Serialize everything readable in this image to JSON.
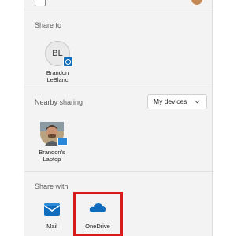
{
  "share_to": {
    "label": "Share to",
    "contact": {
      "initials": "BL",
      "name_line1": "Brandon",
      "name_line2": "LeBlanc"
    }
  },
  "nearby": {
    "label": "Nearby sharing",
    "dropdown_value": "My devices",
    "device": {
      "name_line1": "Brandon's",
      "name_line2": "Laptop"
    }
  },
  "share_with": {
    "label": "Share with",
    "apps": [
      {
        "label": "Mail",
        "icon": "mail-icon",
        "color": "#0f6cbd"
      },
      {
        "label": "OneDrive",
        "icon": "onedrive-icon",
        "color": "#0f6cbd",
        "highlighted": true
      }
    ]
  },
  "colors": {
    "highlight": "#d91a1a",
    "accent": "#0f6cbd"
  }
}
